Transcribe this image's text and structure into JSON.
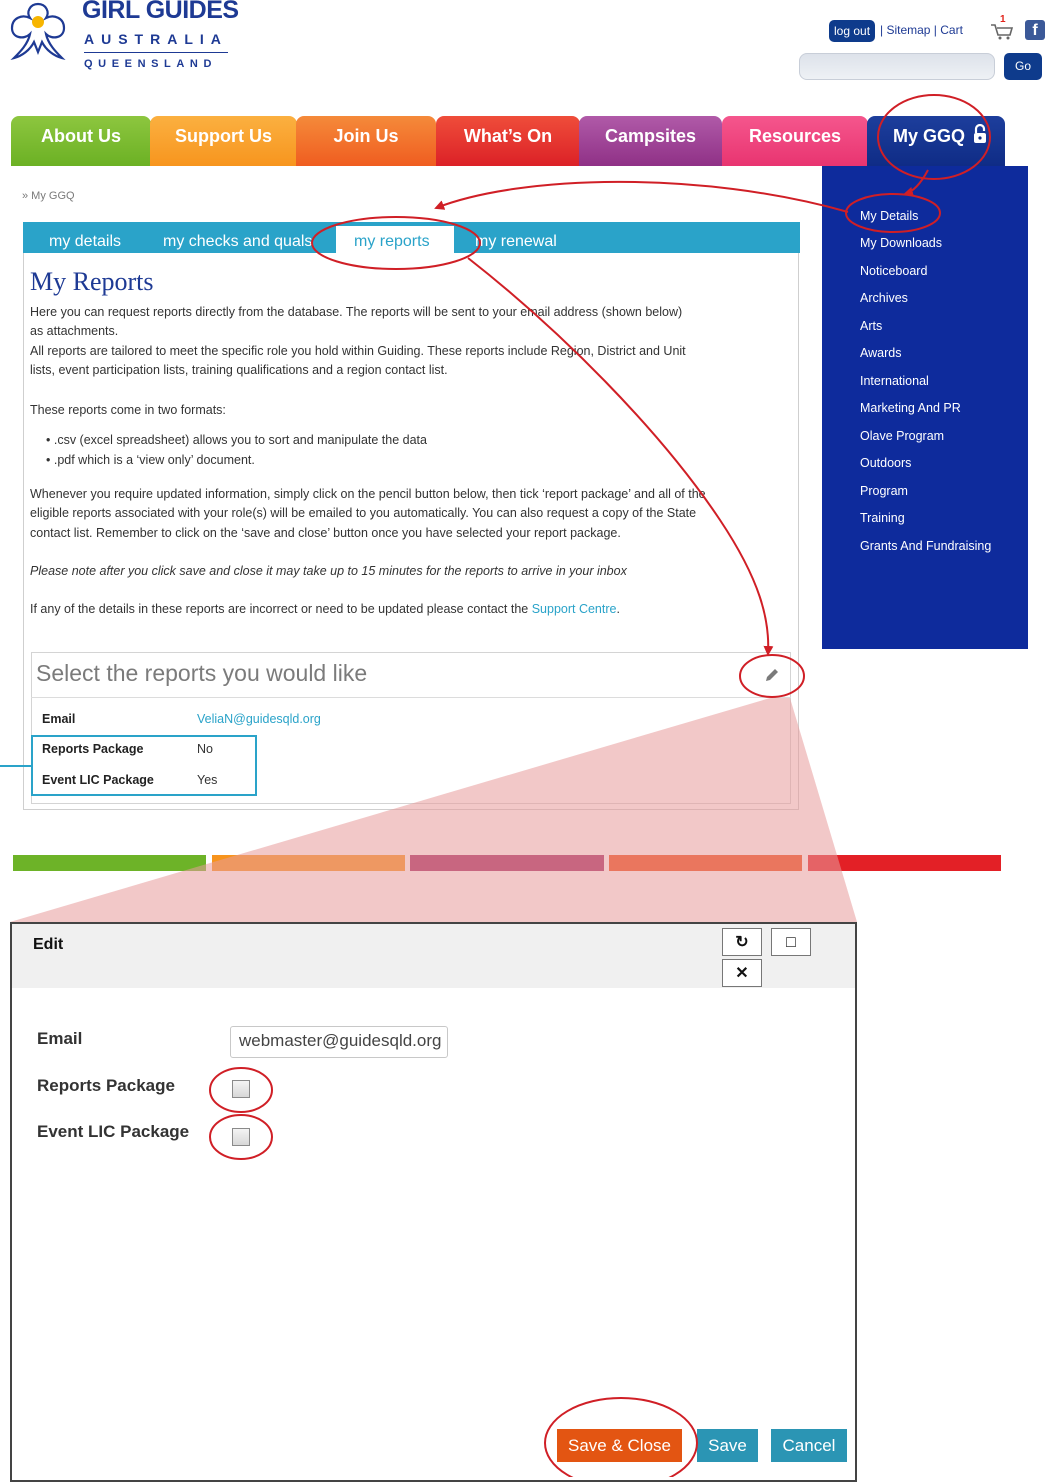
{
  "header": {
    "logo_line1": "GIRL GUIDES",
    "logo_line2": "AUSTRALIA",
    "logo_line3": "QUEENSLAND",
    "logout_label": "log out",
    "links_text": "| Sitemap | Cart",
    "cart_count": "1",
    "search_placeholder": "",
    "go_label": "Go"
  },
  "nav": {
    "tabs": [
      "About Us",
      "Support Us",
      "Join Us",
      "What’s On",
      "Campsites",
      "Resources",
      "My GGQ"
    ]
  },
  "sidebar": {
    "items": [
      "My Details",
      "My Downloads",
      "Noticeboard",
      "Archives",
      "Arts",
      "Awards",
      "International",
      "Marketing And PR",
      "Olave Program",
      "Outdoors",
      "Program",
      "Training",
      "Grants And Fundraising"
    ]
  },
  "breadcrumb": "»  My GGQ",
  "subtabs": {
    "items": [
      "my details",
      "my checks and quals",
      "my reports",
      "my renewal"
    ],
    "active": "my reports"
  },
  "content": {
    "title": "My Reports",
    "p1a": "Here you can request reports directly from the database.  The reports will be sent to your email address (shown below)",
    "p1b": "as attachments.",
    "p2a": "All reports are tailored to meet the specific role you hold within Guiding.  These reports include Region, District and Unit",
    "p2b": "lists, event participation lists, training qualifications and a region contact list.",
    "p3": "These reports come in two formats:",
    "bullet1": "•  .csv (excel spreadsheet) allows you to sort and manipulate the data",
    "bullet2": "•  .pdf which is a ‘view only’ document.",
    "p4a": "Whenever you require updated information, simply click on the pencil button below, then tick ‘report package’ and all of the",
    "p4b": "eligible reports associated with your role(s) will be emailed to you automatically.  You can also request a copy of the State",
    "p4c": "contact list.  Remember to click on the ‘save and close’ button once you have selected your report package.",
    "p5": "Please note after you click save and close it may take up to 15 minutes for the reports to arrive in your inbox",
    "p6_prefix": "If any of the details in these reports are incorrect or need to be updated please contact the ",
    "p6_link": "Support Centre",
    "p6_suffix": "."
  },
  "select_box": {
    "title": "Select the reports you would like",
    "rows": [
      {
        "label": "Email",
        "value": "VeliaN@guidesqld.org"
      },
      {
        "label": "Reports Package",
        "value": "No"
      },
      {
        "label": "Event LIC Package",
        "value": "Yes"
      }
    ]
  },
  "modal": {
    "title": "Edit",
    "email_label": "Email",
    "email_value": "webmaster@guidesqld.org",
    "reports_label": "Reports Package",
    "event_label": "Event LIC Package",
    "save_close_label": "Save & Close",
    "save_label": "Save",
    "cancel_label": "Cancel"
  },
  "colors": {
    "brand_blue": "#1e3a94",
    "subtab_blue": "#2aa3c9",
    "annotation_red": "#d01f26",
    "save_close_orange": "#e35512"
  }
}
